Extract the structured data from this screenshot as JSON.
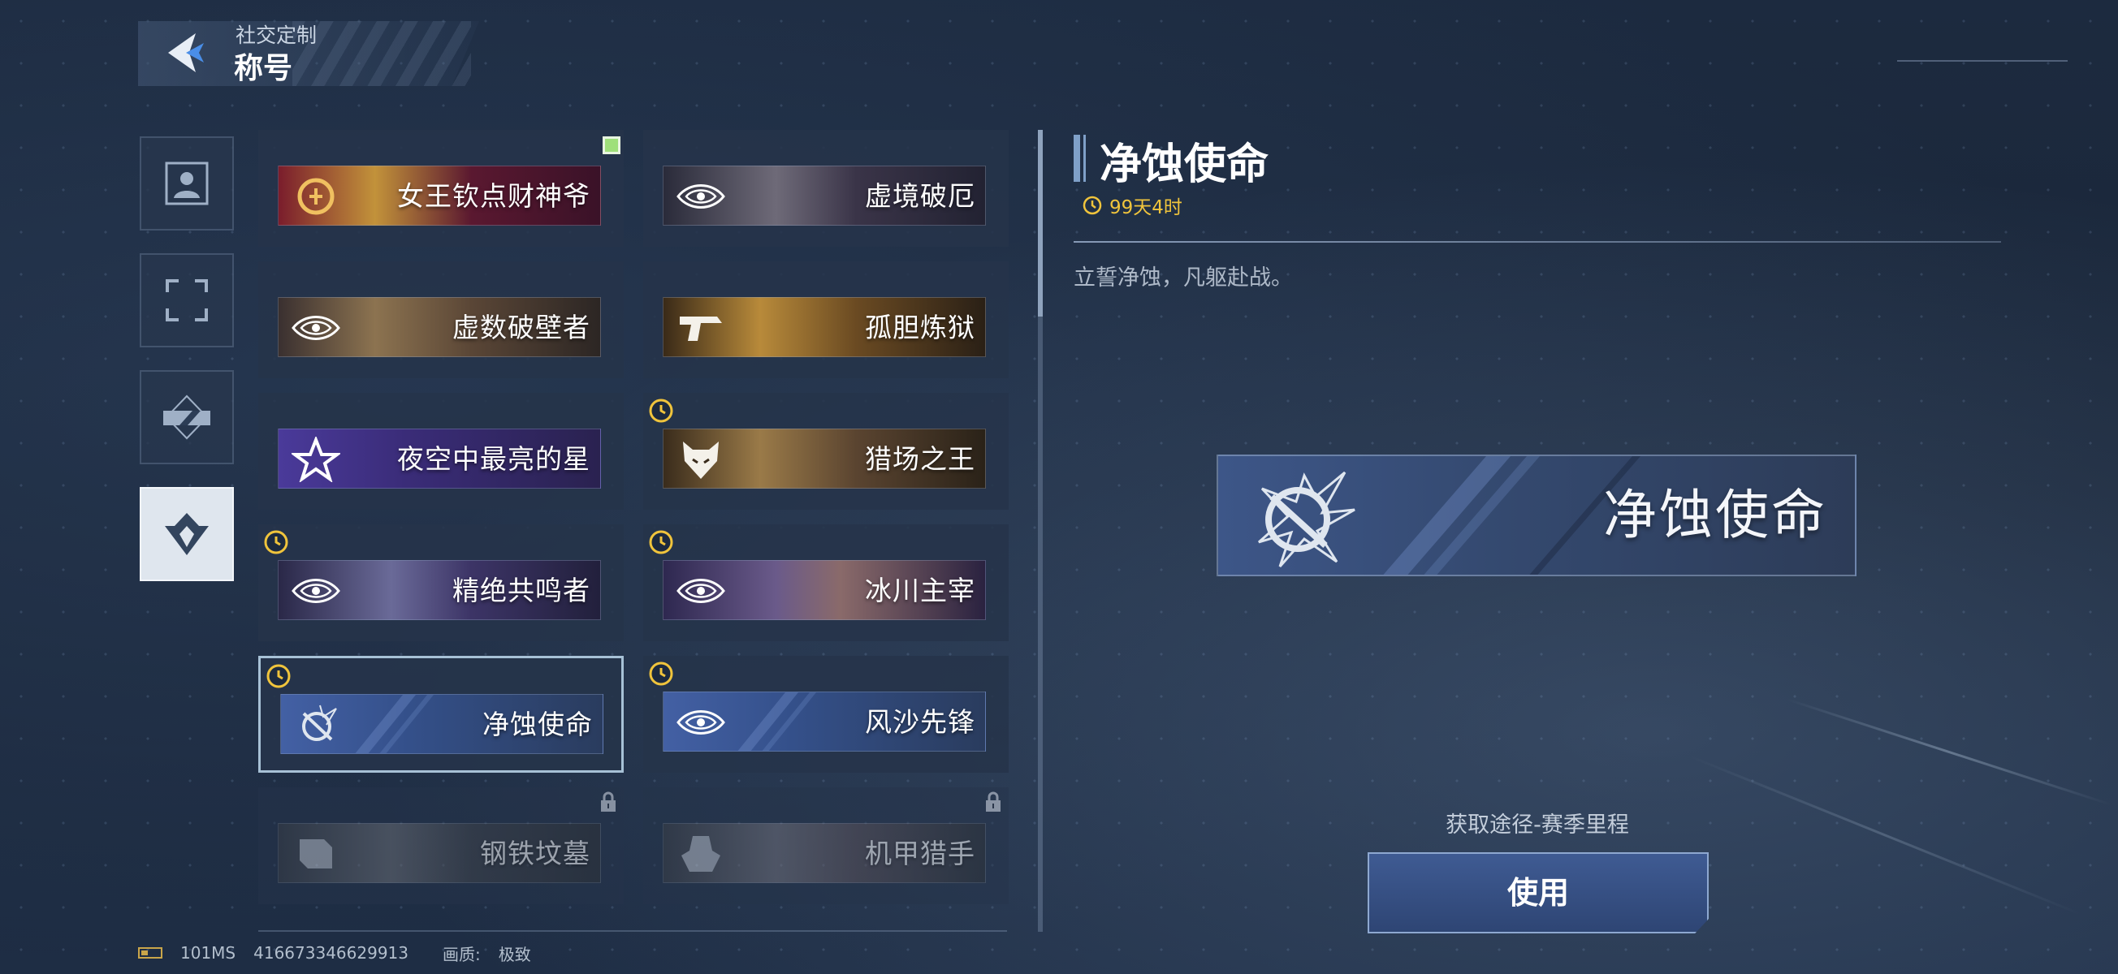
{
  "header": {
    "section": "社交定制",
    "title": "称号"
  },
  "categories": [
    {
      "name": "avatar",
      "icon": "person-icon",
      "active": false
    },
    {
      "name": "frame",
      "icon": "frame-icon",
      "active": false
    },
    {
      "name": "card",
      "icon": "card-icon",
      "active": false
    },
    {
      "name": "title",
      "icon": "title-emblem-icon",
      "active": true
    }
  ],
  "titles": [
    {
      "label": "女王钦点财神爷",
      "theme": "red-gold",
      "new": true,
      "limited": false,
      "locked": false,
      "selected": false
    },
    {
      "label": "虚境破厄",
      "theme": "dark-mech",
      "new": false,
      "limited": false,
      "locked": false,
      "selected": false
    },
    {
      "label": "虚数破壁者",
      "theme": "bronze-crystal",
      "new": false,
      "limited": false,
      "locked": false,
      "selected": false
    },
    {
      "label": "孤胆炼狱",
      "theme": "gold-fire",
      "new": false,
      "limited": false,
      "locked": false,
      "selected": false
    },
    {
      "label": "夜空中最亮的星",
      "theme": "purple-star",
      "new": false,
      "limited": false,
      "locked": false,
      "selected": false
    },
    {
      "label": "猎场之王",
      "theme": "gold-hunter",
      "new": false,
      "limited": true,
      "locked": false,
      "selected": false
    },
    {
      "label": "精绝共鸣者",
      "theme": "purple-mech",
      "new": false,
      "limited": true,
      "locked": false,
      "selected": false
    },
    {
      "label": "冰川主宰",
      "theme": "purple-glacier",
      "new": false,
      "limited": true,
      "locked": false,
      "selected": false
    },
    {
      "label": "净蚀使命",
      "theme": "blue-stripe",
      "new": false,
      "limited": true,
      "locked": false,
      "selected": true
    },
    {
      "label": "风沙先锋",
      "theme": "blue-stripe",
      "new": false,
      "limited": true,
      "locked": false,
      "selected": false
    },
    {
      "label": "钢铁坟墓",
      "theme": "gray-mech",
      "new": false,
      "limited": false,
      "locked": true,
      "selected": false
    },
    {
      "label": "机甲猎手",
      "theme": "gray-warrior",
      "new": false,
      "limited": false,
      "locked": true,
      "selected": false
    }
  ],
  "detail": {
    "title": "净蚀使命",
    "remaining": "99天4时",
    "description": "立誓净蚀，凡躯赴战。",
    "preview_label": "净蚀使命",
    "source": "获取途径-赛季里程",
    "use_button": "使用"
  },
  "footer": {
    "ping": "101MS",
    "uid": "416673346629913",
    "quality_label": "画质:",
    "quality_value": "极致"
  },
  "colors": {
    "accent": "#7fa0c8",
    "timer": "#f0c43c",
    "new_badge": "#9fe07a"
  }
}
